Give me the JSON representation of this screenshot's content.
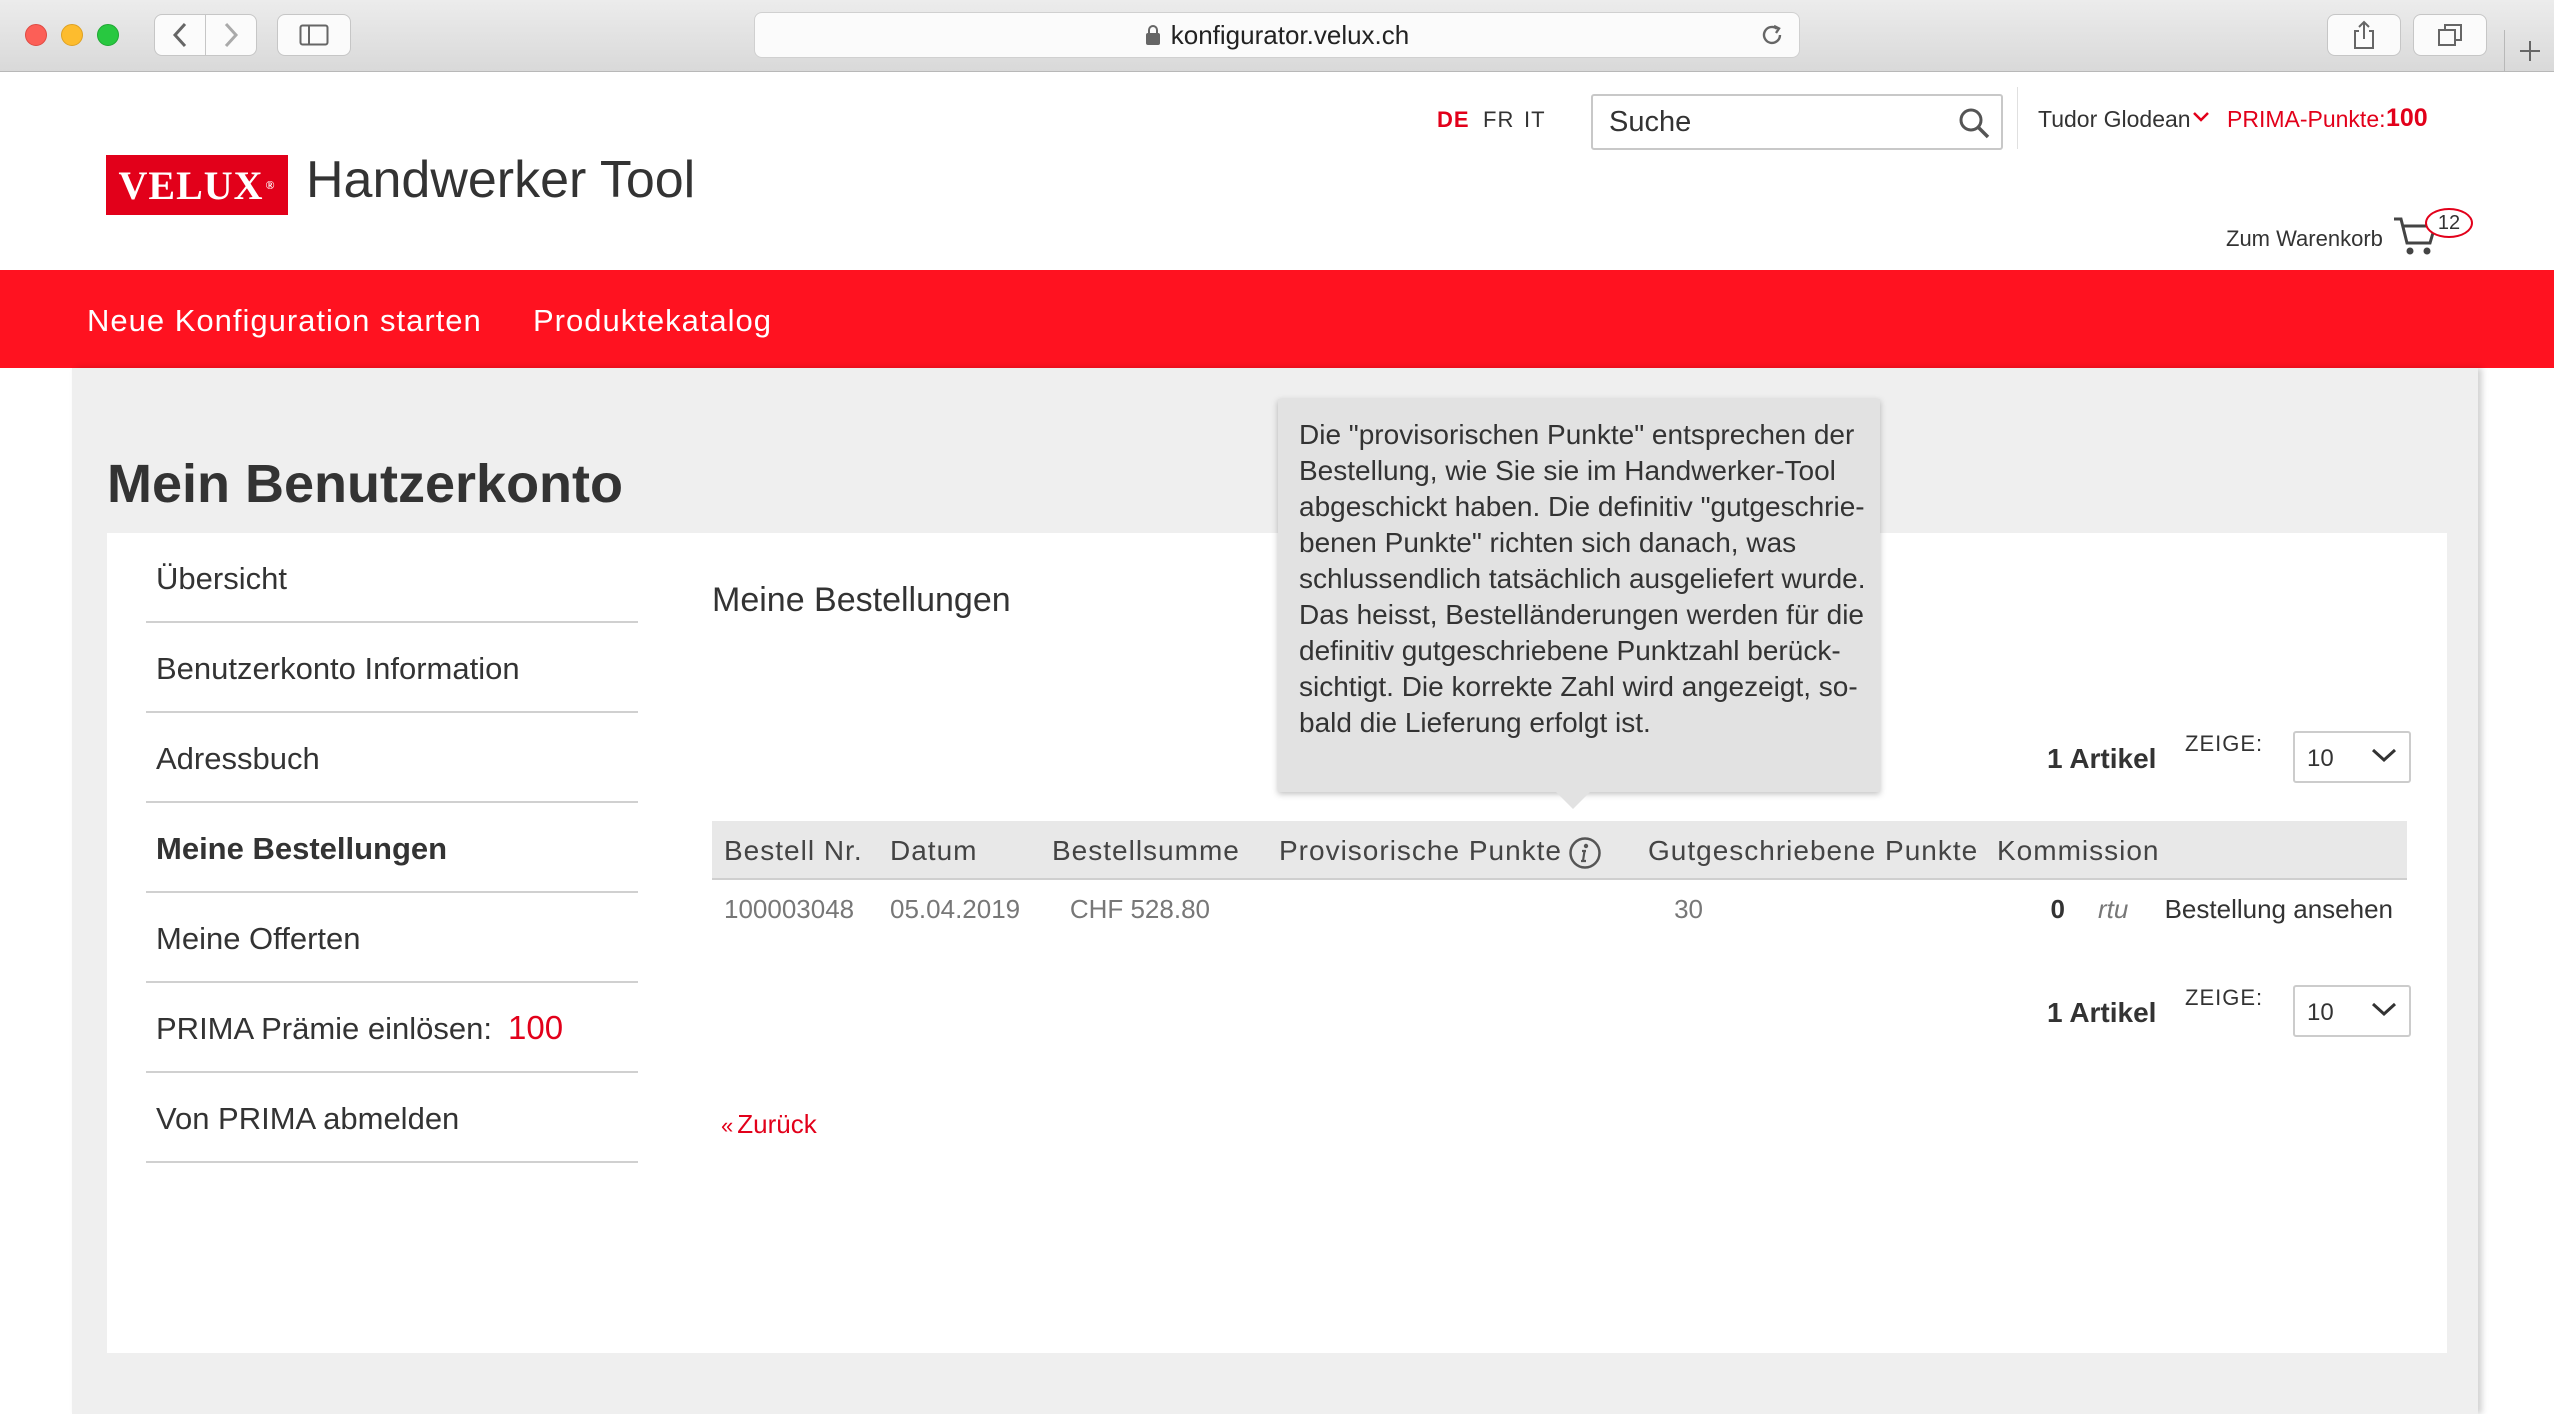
{
  "browser": {
    "url": "konfigurator.velux.ch"
  },
  "header": {
    "languages": [
      "DE",
      "FR",
      "IT"
    ],
    "search_placeholder": "Suche",
    "user_name": "Tudor Glodean",
    "prima_label": "PRIMA-Punkte:",
    "prima_points": "100",
    "logo_text": "VELUX",
    "logo_mark": "®",
    "tool_title": "Handwerker Tool",
    "cart_label": "Zum Warenkorb",
    "cart_count": "12"
  },
  "nav": {
    "items": [
      "Neue Konfiguration starten",
      "Produktekatalog"
    ]
  },
  "page_title": "Mein Benutzerkonto",
  "sidebar": {
    "items": [
      {
        "label": "Übersicht"
      },
      {
        "label": "Benutzerkonto Information"
      },
      {
        "label": "Adressbuch"
      },
      {
        "label": "Meine Bestellungen",
        "active": true
      },
      {
        "label": "Meine Offerten"
      },
      {
        "label": "PRIMA Prämie einlösen:",
        "points": "100"
      },
      {
        "label": "Von PRIMA abmelden"
      }
    ]
  },
  "orders": {
    "title": "Meine Bestellungen",
    "count_label": "1 Artikel",
    "show_label": "ZEIGE:",
    "page_size": "10",
    "columns": [
      "Bestell Nr.",
      "Datum",
      "Bestellsumme",
      "Provisorische Punkte",
      "Gutgeschriebene Punkte",
      "Kommission"
    ],
    "rows": [
      {
        "order_no": "100003048",
        "date": "05.04.2019",
        "total": "CHF 528.80",
        "provisional_points": "30",
        "credited_points": "0",
        "commission": "rtu",
        "action": "Bestellung ansehen"
      }
    ],
    "back_label": "Zurück",
    "back_prefix": "«"
  },
  "tooltip": {
    "lines": [
      "Die \"provisorischen Punkte\" entsprechen der",
      "Bestellung, wie Sie sie im Handwerker-Tool",
      "abgeschickt haben. Die definitiv \"gutgeschrie-",
      "benen Punkte\" richten sich danach, was",
      "schlussendlich tatsächlich ausgeliefert wurde.",
      "Das heisst, Bestelländerungen werden für die",
      "definitiv gutgeschriebene Punktzahl berück-",
      "sichtigt. Die korrekte Zahl wird angezeigt, so-",
      "bald die Lieferung erfolgt ist."
    ]
  },
  "colors": {
    "brand_red": "#e2001a",
    "nav_red": "#ff1220",
    "page_bg": "#efefef",
    "tooltip_bg": "#e2e2e2"
  },
  "icons": [
    "back-icon",
    "forward-icon",
    "sidebar-icon",
    "lock-icon",
    "reload-icon",
    "share-icon",
    "tabs-icon",
    "new-tab-icon",
    "search-icon",
    "chevron-down-icon",
    "cart-icon",
    "info-icon"
  ]
}
